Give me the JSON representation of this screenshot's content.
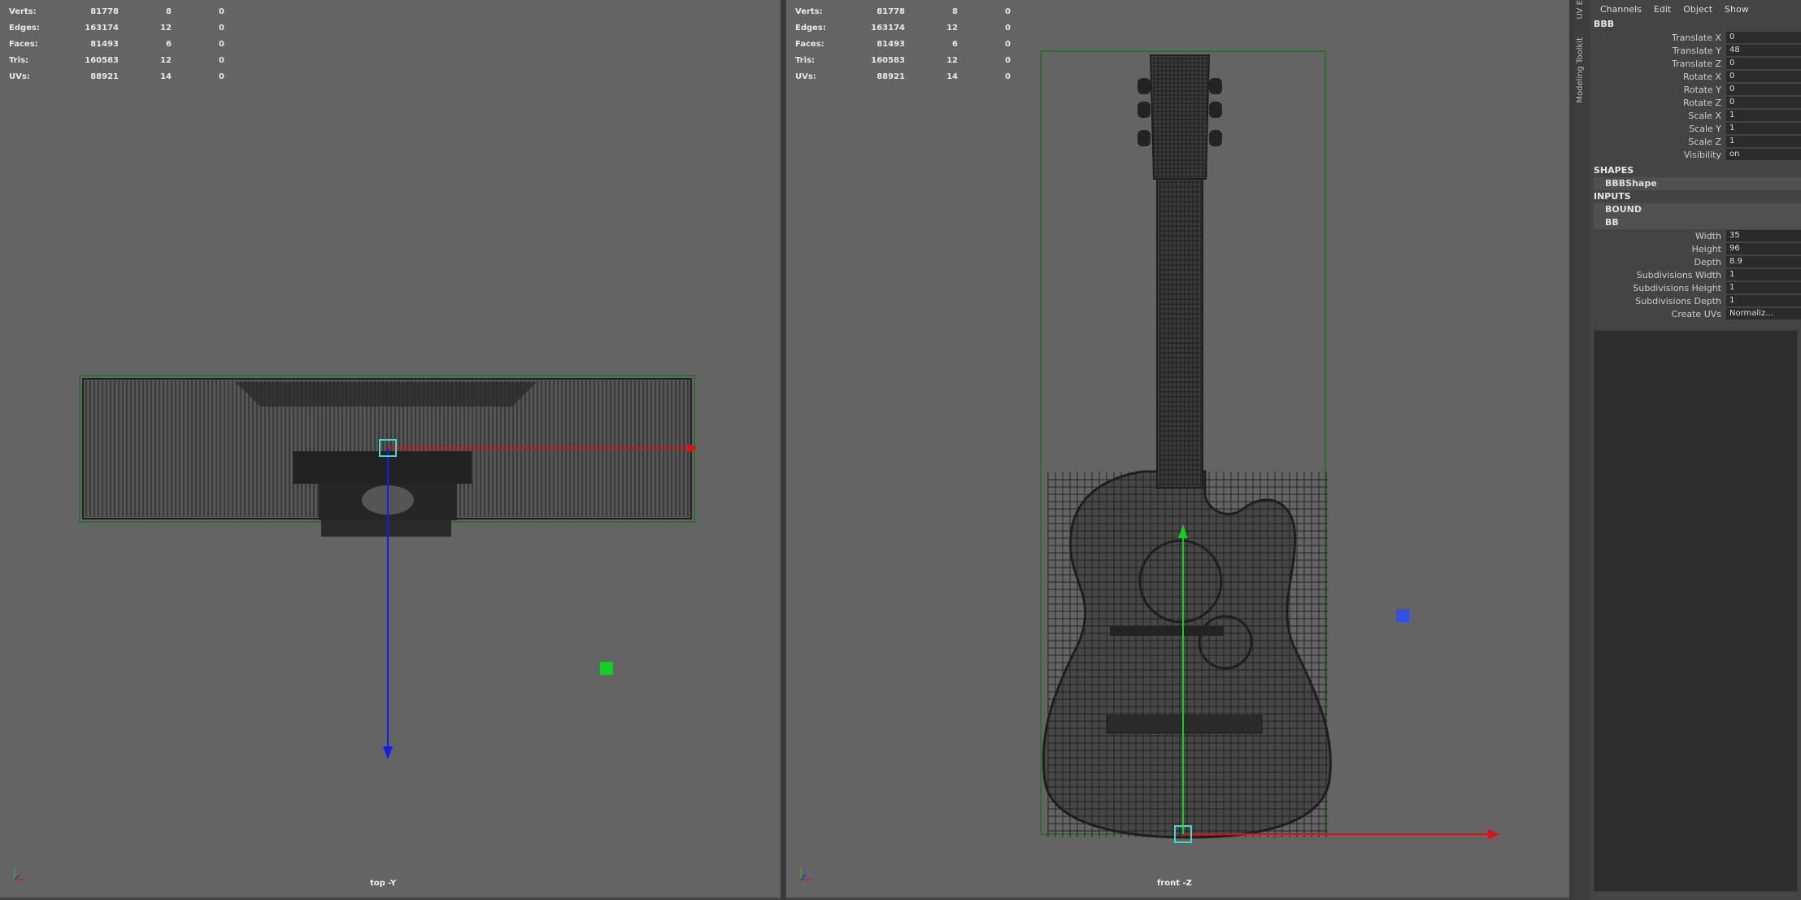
{
  "hud_stats": [
    {
      "label": "Verts:",
      "v1": "81778",
      "v2": "8",
      "v3": "0"
    },
    {
      "label": "Edges:",
      "v1": "163174",
      "v2": "12",
      "v3": "0"
    },
    {
      "label": "Faces:",
      "v1": "81493",
      "v2": "6",
      "v3": "0"
    },
    {
      "label": "Tris:",
      "v1": "160583",
      "v2": "12",
      "v3": "0"
    },
    {
      "label": "UVs:",
      "v1": "88921",
      "v2": "14",
      "v3": "0"
    }
  ],
  "viewports": {
    "left": {
      "camera": "top -Y"
    },
    "right": {
      "camera": "front -Z"
    }
  },
  "side_tabs": [
    "UV E",
    "Modeling Toolkit"
  ],
  "channel_box": {
    "menu": [
      "Channels",
      "Edit",
      "Object",
      "Show"
    ],
    "object_name": "BBB",
    "transform_attrs": [
      {
        "name": "Translate X",
        "value": "0"
      },
      {
        "name": "Translate Y",
        "value": "48"
      },
      {
        "name": "Translate Z",
        "value": "0"
      },
      {
        "name": "Rotate X",
        "value": "0"
      },
      {
        "name": "Rotate Y",
        "value": "0"
      },
      {
        "name": "Rotate Z",
        "value": "0"
      },
      {
        "name": "Scale X",
        "value": "1"
      },
      {
        "name": "Scale Y",
        "value": "1"
      },
      {
        "name": "Scale Z",
        "value": "1"
      },
      {
        "name": "Visibility",
        "value": "on"
      }
    ],
    "shapes_header": "SHAPES",
    "shape_name": "BBBShape",
    "inputs_header": "INPUTS",
    "input_bound": "BOUND",
    "input_node": "BB",
    "input_attrs": [
      {
        "name": "Width",
        "value": "35"
      },
      {
        "name": "Height",
        "value": "96"
      },
      {
        "name": "Depth",
        "value": "8.9"
      },
      {
        "name": "Subdivisions Width",
        "value": "1"
      },
      {
        "name": "Subdivisions Height",
        "value": "1"
      },
      {
        "name": "Subdivisions Depth",
        "value": "1"
      },
      {
        "name": "Create UVs",
        "value": "Normaliz..."
      }
    ]
  },
  "colors": {
    "viewport_bg": "#646464",
    "wire": "#1e1e1e",
    "bbox": "#2f6e2f",
    "x_axis": "#e01010",
    "y_axis": "#10d020",
    "z_axis": "#1020e0",
    "manip": "#40d8c8"
  }
}
